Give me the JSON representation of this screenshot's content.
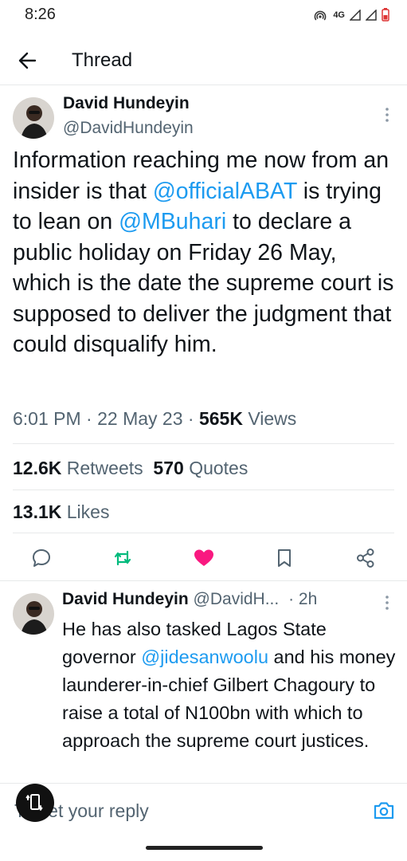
{
  "status_bar": {
    "time": "8:26",
    "network": "4G",
    "icons": [
      "hotspot-icon",
      "signal-icon",
      "signal-icon",
      "battery-icon"
    ]
  },
  "header": {
    "title": "Thread",
    "back_icon": "back-arrow-icon"
  },
  "tweet": {
    "author_name": "David Hundeyin",
    "author_handle": "@DavidHundeyin",
    "text_segments": [
      "Information reaching me now from an insider is that ",
      "@officialABAT",
      " is trying to lean on ",
      "@MBuhari",
      " to declare a public holiday on Friday 26 May, which is the date the supreme court is supposed to deliver the judgment that could disqualify him."
    ],
    "time": "6:01 PM",
    "date": "22 May 23",
    "views_count": "565K",
    "views_label": "Views",
    "retweets_count": "12.6K",
    "retweets_label": "Retweets",
    "quotes_count": "570",
    "quotes_label": "Quotes",
    "likes_count": "13.1K",
    "likes_label": "Likes"
  },
  "actions": [
    {
      "name": "reply",
      "icon": "comment-icon"
    },
    {
      "name": "retweet",
      "icon": "retweet-icon"
    },
    {
      "name": "like",
      "icon": "heart-icon"
    },
    {
      "name": "bookmark",
      "icon": "bookmark-icon"
    },
    {
      "name": "share",
      "icon": "share-icon"
    }
  ],
  "reply": {
    "author_name": "David Hundeyin",
    "author_handle": "@DavidH...",
    "time_ago": "· 2h",
    "text_segments": [
      "He has also tasked Lagos State governor ",
      "@jidesanwoolu",
      " and his money launderer-in-chief Gilbert Chagoury to raise a total of N100bn with which to approach the supreme court justices."
    ]
  },
  "composer": {
    "placeholder": "Tweet your reply",
    "camera_icon": "camera-icon"
  },
  "colors": {
    "accent": "#1d9bf0",
    "retweet_green": "#00ba7c",
    "like_pink": "#f91880",
    "text_primary": "#0f1419",
    "text_secondary": "#536471",
    "divider": "#e7e9ea"
  }
}
